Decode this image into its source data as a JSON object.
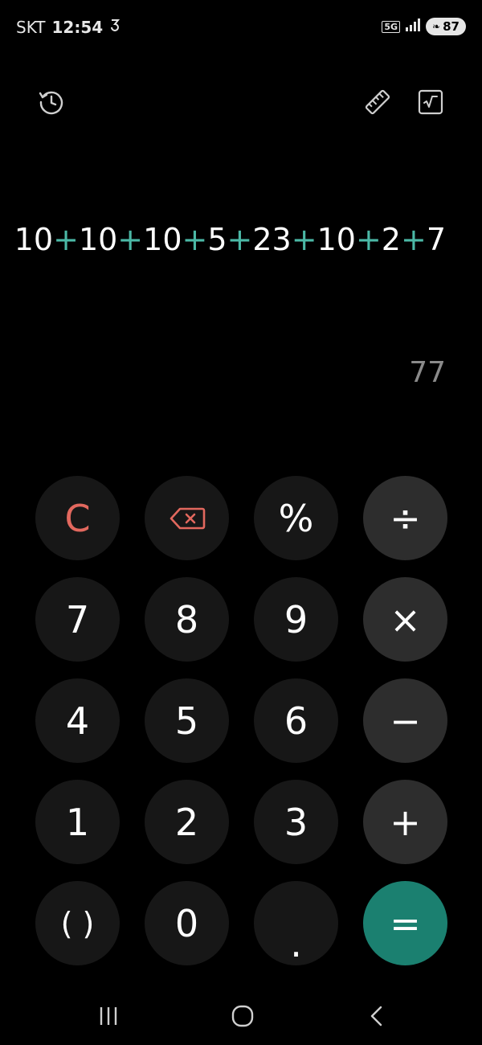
{
  "status_bar": {
    "carrier": "SKT",
    "time": "12:54",
    "network": "5G",
    "battery": "87"
  },
  "toolbar": {
    "history_icon": "history-icon",
    "ruler_icon": "ruler-icon",
    "scientific_icon": "sqrt-icon"
  },
  "display": {
    "expression_parts": [
      "10",
      "+",
      "10",
      "+",
      "10",
      "+",
      "5",
      "+",
      "23",
      "+",
      "10",
      "+",
      "2",
      "+",
      "7"
    ],
    "result": "77"
  },
  "keypad": {
    "clear": "C",
    "backspace_icon": "backspace-icon",
    "percent": "%",
    "divide": "÷",
    "seven": "7",
    "eight": "8",
    "nine": "9",
    "multiply": "×",
    "four": "4",
    "five": "5",
    "six": "6",
    "minus": "−",
    "one": "1",
    "two": "2",
    "three": "3",
    "plus": "+",
    "parentheses": "( )",
    "zero": "0",
    "decimal": ".",
    "equals": "="
  },
  "colors": {
    "accent": "#1b8070",
    "operator_text": "#4bb8a6",
    "clear_text": "#e2685e"
  }
}
